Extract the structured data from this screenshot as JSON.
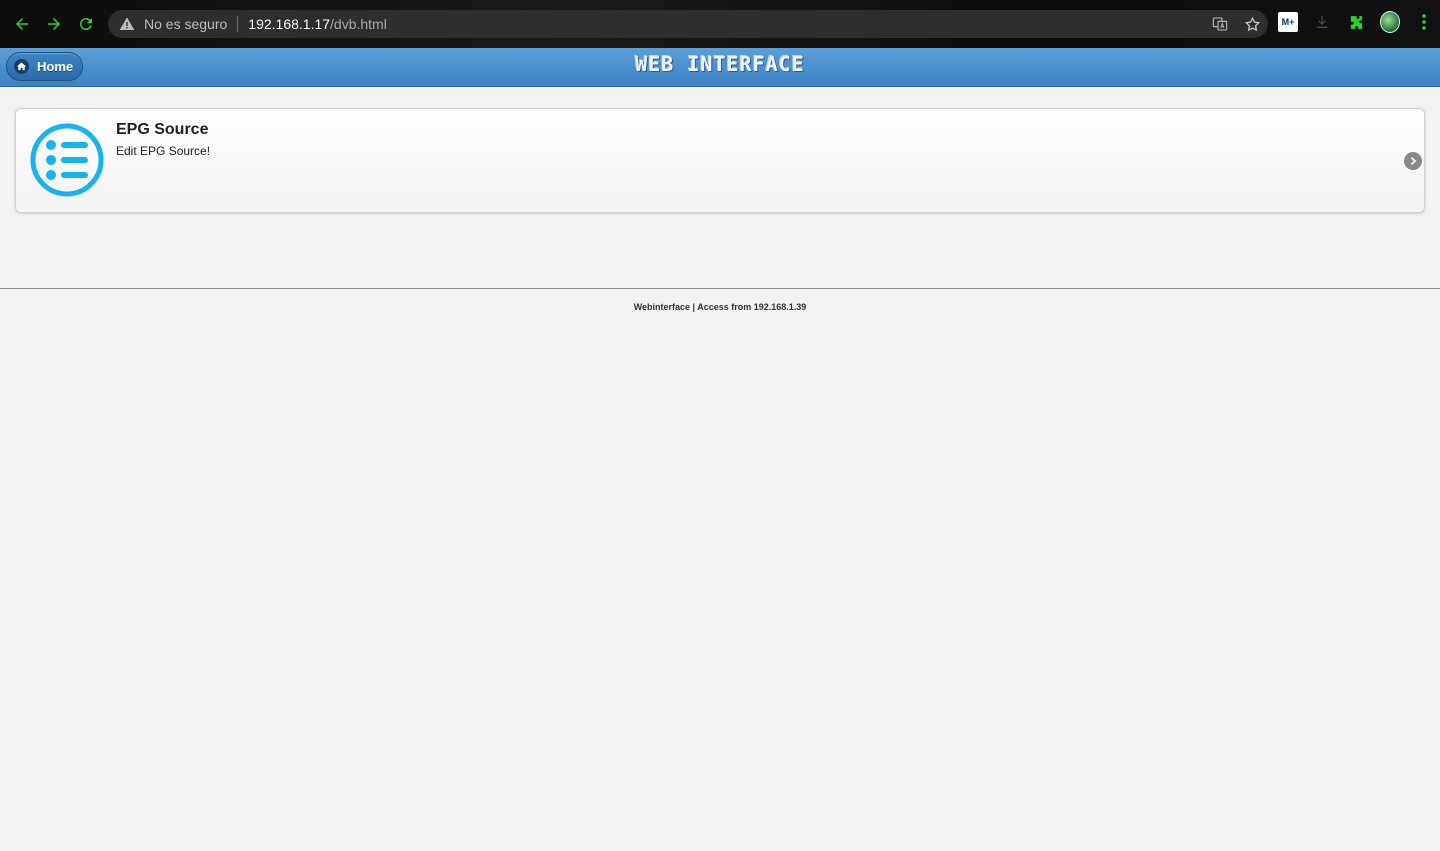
{
  "browser": {
    "security_label": "No es seguro",
    "url_host": "192.168.1.17",
    "url_path": "/dvb.html",
    "extension_label": "M+"
  },
  "header": {
    "home_label": "Home",
    "logo_text": "WEB INTERFACE",
    "accent_color": "#3b82c4"
  },
  "items": [
    {
      "title": "EPG Source",
      "description": "Edit EPG Source!",
      "icon": "list-icon",
      "icon_color": "#17b3ee"
    }
  ],
  "footer": {
    "text": "Webinterface | Access from 192.168.1.39"
  }
}
